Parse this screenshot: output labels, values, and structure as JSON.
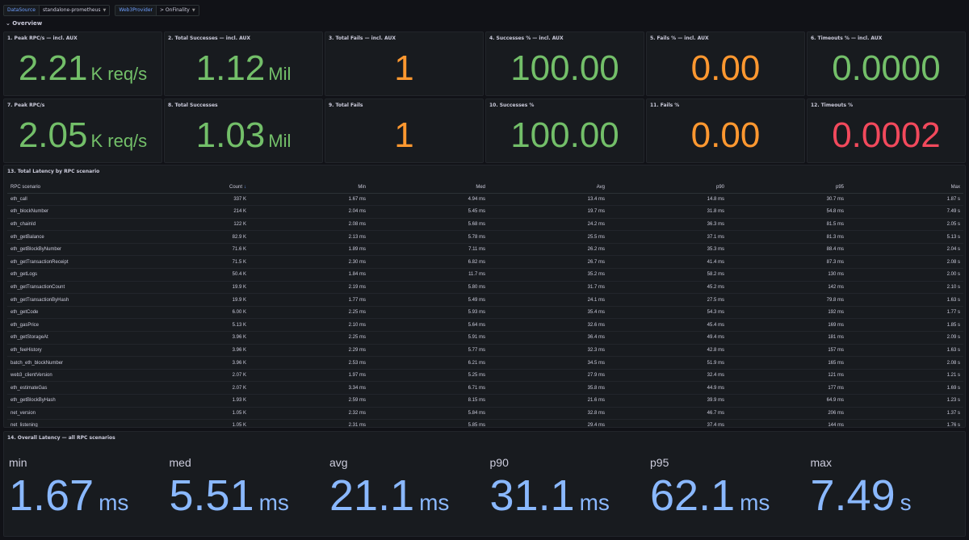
{
  "variables": [
    {
      "label": "DataSource",
      "value": "standalone-prometheus",
      "has_caret": true
    },
    {
      "label": "Web3Provider",
      "value": "> OnFinality",
      "has_caret": true
    }
  ],
  "row_title": "⌄ Overview",
  "stats": [
    {
      "title": "1. Peak RPC/s — incl. AUX",
      "value": "2.21",
      "unit": "K req/s",
      "color": "#73bf69"
    },
    {
      "title": "2. Total Successes — incl. AUX",
      "value": "1.12",
      "unit": "Mil",
      "color": "#73bf69"
    },
    {
      "title": "3. Total Fails — incl. AUX",
      "value": "1",
      "unit": "",
      "color": "#ff9830"
    },
    {
      "title": "4. Successes % — incl. AUX",
      "value": "100.00",
      "unit": "",
      "color": "#73bf69"
    },
    {
      "title": "5. Fails % — incl. AUX",
      "value": "0.00",
      "unit": "",
      "color": "#ff9830"
    },
    {
      "title": "6. Timeouts % — incl. AUX",
      "value": "0.0000",
      "unit": "",
      "color": "#73bf69"
    },
    {
      "title": "7. Peak RPC/s",
      "value": "2.05",
      "unit": "K req/s",
      "color": "#73bf69"
    },
    {
      "title": "8. Total Successes",
      "value": "1.03",
      "unit": "Mil",
      "color": "#73bf69"
    },
    {
      "title": "9. Total Fails",
      "value": "1",
      "unit": "",
      "color": "#ff9830"
    },
    {
      "title": "10. Successes %",
      "value": "100.00",
      "unit": "",
      "color": "#73bf69"
    },
    {
      "title": "11. Fails %",
      "value": "0.00",
      "unit": "",
      "color": "#ff9830"
    },
    {
      "title": "12. Timeouts %",
      "value": "0.0002",
      "unit": "",
      "color": "#f2495c"
    }
  ],
  "latency_table": {
    "title": "13. Total Latency by RPC scenario",
    "columns": [
      "RPC scenario",
      "Count",
      "Min",
      "Med",
      "Avg",
      "p90",
      "p95",
      "Max"
    ],
    "sort_icon": "sort-desc-icon",
    "rows": [
      [
        "eth_call",
        "337 K",
        "1.67 ms",
        "4.94 ms",
        "13.4 ms",
        "14.8 ms",
        "30.7 ms",
        "1.87 s"
      ],
      [
        "eth_blockNumber",
        "214 K",
        "2.04 ms",
        "5.45 ms",
        "19.7 ms",
        "31.8 ms",
        "54.8 ms",
        "7.49 s"
      ],
      [
        "eth_chainId",
        "122 K",
        "2.08 ms",
        "5.68 ms",
        "24.2 ms",
        "36.3 ms",
        "81.5 ms",
        "2.05 s"
      ],
      [
        "eth_getBalance",
        "82.9 K",
        "2.13 ms",
        "5.78 ms",
        "25.5 ms",
        "37.1 ms",
        "81.3 ms",
        "5.13 s"
      ],
      [
        "eth_getBlockByNumber",
        "71.6 K",
        "1.89 ms",
        "7.11 ms",
        "26.2 ms",
        "35.3 ms",
        "88.4 ms",
        "2.04 s"
      ],
      [
        "eth_getTransactionReceipt",
        "71.5 K",
        "2.30 ms",
        "6.82 ms",
        "26.7 ms",
        "41.4 ms",
        "87.3 ms",
        "2.08 s"
      ],
      [
        "eth_getLogs",
        "50.4 K",
        "1.84 ms",
        "11.7 ms",
        "35.2 ms",
        "58.2 ms",
        "130 ms",
        "2.00 s"
      ],
      [
        "eth_getTransactionCount",
        "19.9 K",
        "2.19 ms",
        "5.80 ms",
        "31.7 ms",
        "45.2 ms",
        "142 ms",
        "2.10 s"
      ],
      [
        "eth_getTransactionByHash",
        "19.9 K",
        "1.77 ms",
        "5.49 ms",
        "24.1 ms",
        "27.5 ms",
        "79.8 ms",
        "1.63 s"
      ],
      [
        "eth_getCode",
        "6.00 K",
        "2.25 ms",
        "5.93 ms",
        "35.4 ms",
        "54.3 ms",
        "192 ms",
        "1.77 s"
      ],
      [
        "eth_gasPrice",
        "5.13 K",
        "2.10 ms",
        "5.64 ms",
        "32.6 ms",
        "45.4 ms",
        "169 ms",
        "1.85 s"
      ],
      [
        "eth_getStorageAt",
        "3.96 K",
        "2.25 ms",
        "5.91 ms",
        "36.4 ms",
        "49.4 ms",
        "181 ms",
        "2.09 s"
      ],
      [
        "eth_feeHistory",
        "3.96 K",
        "2.29 ms",
        "5.77 ms",
        "32.3 ms",
        "42.8 ms",
        "157 ms",
        "1.63 s"
      ],
      [
        "batch_eth_blockNumber",
        "3.96 K",
        "2.53 ms",
        "6.21 ms",
        "34.5 ms",
        "51.9 ms",
        "165 ms",
        "2.08 s"
      ],
      [
        "web3_clientVersion",
        "2.07 K",
        "1.97 ms",
        "5.25 ms",
        "27.9 ms",
        "32.4 ms",
        "121 ms",
        "1.21 s"
      ],
      [
        "eth_estimateGas",
        "2.07 K",
        "3.34 ms",
        "6.71 ms",
        "35.8 ms",
        "44.9 ms",
        "177 ms",
        "1.69 s"
      ],
      [
        "eth_getBlockByHash",
        "1.93 K",
        "2.59 ms",
        "8.15 ms",
        "21.6 ms",
        "39.9 ms",
        "64.9 ms",
        "1.23 s"
      ],
      [
        "net_version",
        "1.05 K",
        "2.32 ms",
        "5.84 ms",
        "32.8 ms",
        "46.7 ms",
        "206 ms",
        "1.37 s"
      ],
      [
        "net_listening",
        "1.05 K",
        "2.31 ms",
        "5.85 ms",
        "29.4 ms",
        "37.4 ms",
        "144 ms",
        "1.76 s"
      ]
    ]
  },
  "overall_latency": {
    "title": "14. Overall Latency — all RPC scenarios",
    "stats": [
      {
        "name": "min",
        "value": "1.67",
        "unit": "ms"
      },
      {
        "name": "med",
        "value": "5.51",
        "unit": "ms"
      },
      {
        "name": "avg",
        "value": "21.1",
        "unit": "ms"
      },
      {
        "name": "p90",
        "value": "31.1",
        "unit": "ms"
      },
      {
        "name": "p95",
        "value": "62.1",
        "unit": "ms"
      },
      {
        "name": "max",
        "value": "7.49",
        "unit": "s"
      }
    ],
    "color": "#8ab8ff"
  }
}
